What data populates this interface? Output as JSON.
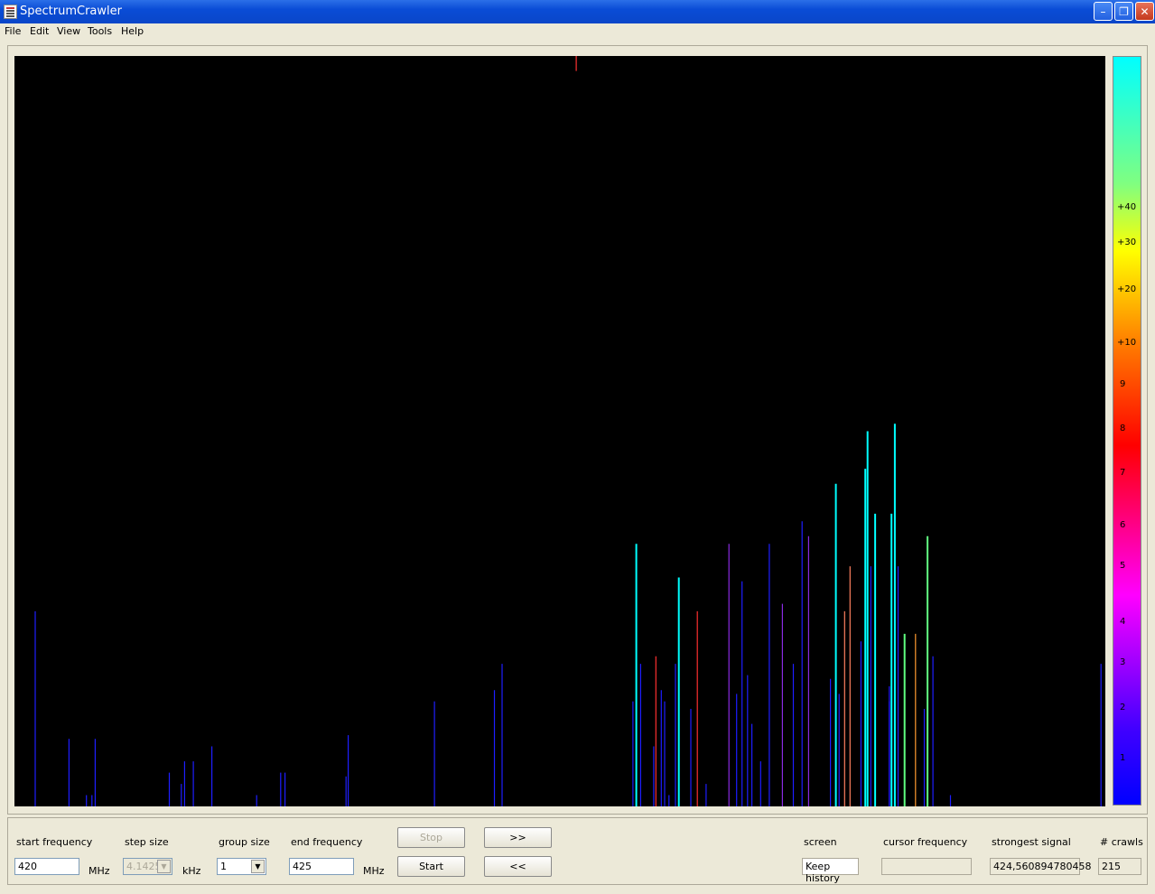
{
  "window": {
    "title": "SpectrumCrawler"
  },
  "menu": [
    "File",
    "Edit",
    "View",
    "Tools",
    "Help"
  ],
  "legend": [
    "+40",
    "+30",
    "+20",
    "+10",
    "9",
    "8",
    "7",
    "6",
    "5",
    "4",
    "3",
    "2",
    "1"
  ],
  "controls": {
    "start_label": "start frequency",
    "start_value": "420",
    "start_unit": "MHz",
    "step_label": "step size",
    "step_value": "4.1425",
    "step_unit": "kHz",
    "group_label": "group size",
    "group_value": "1",
    "end_label": "end frequency",
    "end_value": "425",
    "end_unit": "MHz",
    "stop": "Stop",
    "start": "Start",
    "fwd": ">>",
    "back": "<<",
    "screen_label": "screen",
    "screen_value": "Keep history",
    "cursor_label": "cursor frequency",
    "cursor_value": "",
    "strongest_label": "strongest signal",
    "strongest_value": "424,560894780458",
    "crawls_label": "# crawls",
    "crawls_value": "215"
  },
  "colors": {
    "cyan": "#00ffff",
    "blue": "#1e1eff",
    "violet": "#8a2be2",
    "red": "#ff3030",
    "orange": "#ff9a30",
    "green": "#60ff80",
    "salmon": "#ff8060"
  },
  "chart_data": {
    "type": "bar",
    "x_range_mhz": [
      420,
      425
    ],
    "y_levels": [
      "1",
      "2",
      "3",
      "4",
      "5",
      "6",
      "7",
      "8",
      "9",
      "+10",
      "+20",
      "+30",
      "+40"
    ],
    "lines": [
      {
        "f": 420.095,
        "v": 0.26,
        "c": "blue"
      },
      {
        "f": 420.25,
        "v": 0.09,
        "c": "blue"
      },
      {
        "f": 420.33,
        "v": 0.015,
        "c": "blue"
      },
      {
        "f": 420.355,
        "v": 0.015,
        "c": "blue"
      },
      {
        "f": 420.37,
        "v": 0.09,
        "c": "blue"
      },
      {
        "f": 420.71,
        "v": 0.045,
        "c": "blue"
      },
      {
        "f": 420.765,
        "v": 0.03,
        "c": "blue"
      },
      {
        "f": 420.78,
        "v": 0.06,
        "c": "blue"
      },
      {
        "f": 420.82,
        "v": 0.06,
        "c": "blue"
      },
      {
        "f": 420.905,
        "v": 0.08,
        "c": "blue"
      },
      {
        "f": 421.11,
        "v": 0.015,
        "c": "blue"
      },
      {
        "f": 421.22,
        "v": 0.045,
        "c": "blue"
      },
      {
        "f": 421.24,
        "v": 0.045,
        "c": "blue"
      },
      {
        "f": 421.52,
        "v": 0.04,
        "c": "blue"
      },
      {
        "f": 421.53,
        "v": 0.095,
        "c": "blue"
      },
      {
        "f": 421.925,
        "v": 0.14,
        "c": "blue"
      },
      {
        "f": 422.2,
        "v": 0.155,
        "c": "blue"
      },
      {
        "f": 422.235,
        "v": 0.19,
        "c": "blue"
      },
      {
        "f": 422.575,
        "v": 0.98,
        "c": "red"
      },
      {
        "f": 422.835,
        "v": 0.14,
        "c": "blue"
      },
      {
        "f": 422.85,
        "v": 0.35,
        "c": "cyan"
      },
      {
        "f": 422.87,
        "v": 0.19,
        "c": "blue"
      },
      {
        "f": 422.93,
        "v": 0.08,
        "c": "blue"
      },
      {
        "f": 422.94,
        "v": 0.2,
        "c": "red"
      },
      {
        "f": 422.965,
        "v": 0.155,
        "c": "blue"
      },
      {
        "f": 422.98,
        "v": 0.14,
        "c": "blue"
      },
      {
        "f": 423.0,
        "v": 0.015,
        "c": "blue"
      },
      {
        "f": 423.03,
        "v": 0.19,
        "c": "blue"
      },
      {
        "f": 423.045,
        "v": 0.305,
        "c": "cyan"
      },
      {
        "f": 423.1,
        "v": 0.13,
        "c": "blue"
      },
      {
        "f": 423.13,
        "v": 0.26,
        "c": "red"
      },
      {
        "f": 423.17,
        "v": 0.03,
        "c": "blue"
      },
      {
        "f": 423.275,
        "v": 0.35,
        "c": "violet"
      },
      {
        "f": 423.31,
        "v": 0.15,
        "c": "blue"
      },
      {
        "f": 423.335,
        "v": 0.3,
        "c": "blue"
      },
      {
        "f": 423.36,
        "v": 0.175,
        "c": "blue"
      },
      {
        "f": 423.38,
        "v": 0.11,
        "c": "blue"
      },
      {
        "f": 423.42,
        "v": 0.06,
        "c": "blue"
      },
      {
        "f": 423.46,
        "v": 0.35,
        "c": "blue"
      },
      {
        "f": 423.52,
        "v": 0.27,
        "c": "violet"
      },
      {
        "f": 423.57,
        "v": 0.19,
        "c": "blue"
      },
      {
        "f": 423.61,
        "v": 0.38,
        "c": "blue"
      },
      {
        "f": 423.64,
        "v": 0.36,
        "c": "violet"
      },
      {
        "f": 423.74,
        "v": 0.17,
        "c": "blue"
      },
      {
        "f": 423.765,
        "v": 0.43,
        "c": "cyan"
      },
      {
        "f": 423.78,
        "v": 0.15,
        "c": "blue"
      },
      {
        "f": 423.805,
        "v": 0.26,
        "c": "salmon"
      },
      {
        "f": 423.83,
        "v": 0.32,
        "c": "salmon"
      },
      {
        "f": 423.88,
        "v": 0.22,
        "c": "blue"
      },
      {
        "f": 423.9,
        "v": 0.45,
        "c": "cyan"
      },
      {
        "f": 423.91,
        "v": 0.5,
        "c": "cyan"
      },
      {
        "f": 423.925,
        "v": 0.32,
        "c": "blue"
      },
      {
        "f": 423.945,
        "v": 0.39,
        "c": "cyan"
      },
      {
        "f": 424.01,
        "v": 0.14,
        "c": "blue"
      },
      {
        "f": 424.01,
        "v": 0.16,
        "c": "blue"
      },
      {
        "f": 424.02,
        "v": 0.39,
        "c": "cyan"
      },
      {
        "f": 424.035,
        "v": 0.51,
        "c": "cyan"
      },
      {
        "f": 424.05,
        "v": 0.32,
        "c": "blue"
      },
      {
        "f": 424.08,
        "v": 0.23,
        "c": "green"
      },
      {
        "f": 424.13,
        "v": 0.23,
        "c": "orange"
      },
      {
        "f": 424.17,
        "v": 0.13,
        "c": "blue"
      },
      {
        "f": 424.185,
        "v": 0.36,
        "c": "green"
      },
      {
        "f": 424.21,
        "v": 0.2,
        "c": "blue"
      },
      {
        "f": 424.29,
        "v": 0.015,
        "c": "blue"
      },
      {
        "f": 424.98,
        "v": 0.19,
        "c": "blue"
      }
    ]
  }
}
